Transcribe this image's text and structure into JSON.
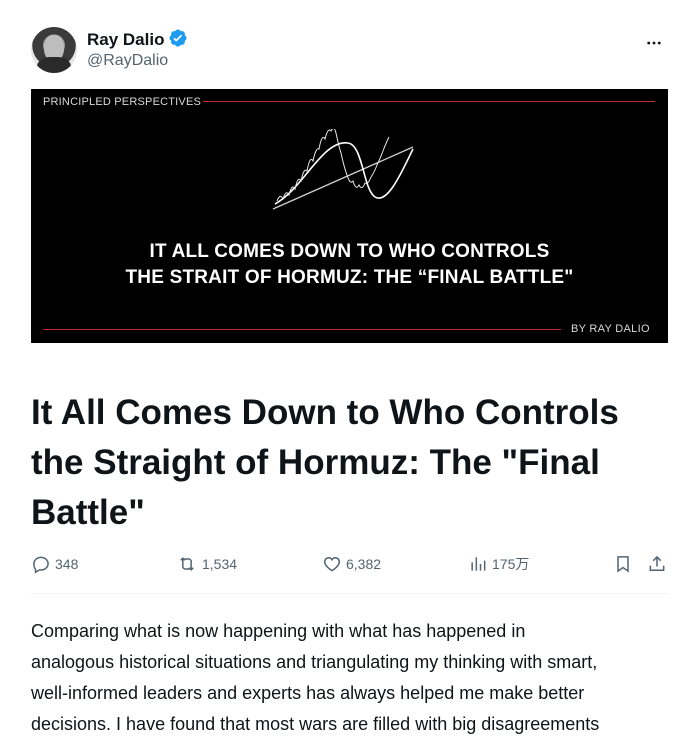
{
  "author": {
    "display_name": "Ray Dalio",
    "handle": "@RayDalio"
  },
  "banner": {
    "series_label": "PRINCIPLED PERSPECTIVES",
    "title_line1": "IT ALL COMES DOWN TO WHO CONTROLS",
    "title_line2": "THE STRAIT OF HORMUZ: THE “FINAL BATTLE\"",
    "byline": "BY RAY DALIO"
  },
  "article": {
    "title": "It All Comes Down to Who Controls the Straight of Hormuz: The \"Final Battle\"",
    "body_lines": [
      "Comparing what is now happening with what has happened in",
      "analogous historical situations and triangulating my thinking with smart,",
      "well-informed leaders and experts has always helped me make better",
      "decisions. I have found that most wars are filled with big disagreements"
    ]
  },
  "stats": {
    "replies": "348",
    "reposts": "1,534",
    "likes": "6,382",
    "views": "175万"
  },
  "icons": {
    "verified": "verified-badge-icon",
    "more": "more-icon",
    "reply": "reply-icon",
    "repost": "repost-icon",
    "like": "like-icon",
    "views": "views-icon",
    "bookmark": "bookmark-icon",
    "share": "share-icon"
  },
  "colors": {
    "verified_blue": "#1d9bf0",
    "banner_line_red": "#c0282a",
    "muted_text": "#536471"
  }
}
